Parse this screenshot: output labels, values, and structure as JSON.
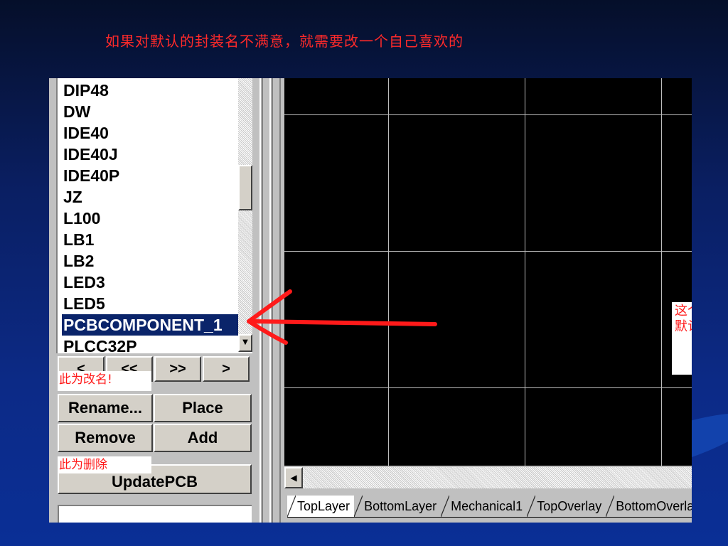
{
  "slide": {
    "title": "如果对默认的封装名不满意，就需要改一个自己喜欢的"
  },
  "component_list": {
    "items": [
      {
        "label": "DIP48",
        "selected": false
      },
      {
        "label": "DW",
        "selected": false
      },
      {
        "label": "IDE40",
        "selected": false
      },
      {
        "label": "IDE40J",
        "selected": false
      },
      {
        "label": "IDE40P",
        "selected": false
      },
      {
        "label": "JZ",
        "selected": false
      },
      {
        "label": "L100",
        "selected": false
      },
      {
        "label": "LB1",
        "selected": false
      },
      {
        "label": "LB2",
        "selected": false
      },
      {
        "label": "LED3",
        "selected": false
      },
      {
        "label": "LED5",
        "selected": false
      },
      {
        "label": "PCBCOMPONENT_1",
        "selected": true
      },
      {
        "label": "PLCC32P",
        "selected": false
      }
    ]
  },
  "nav_buttons": [
    "<",
    "<<",
    ">>",
    ">"
  ],
  "buttons": {
    "rename": "Rename...",
    "place": "Place",
    "remove": "Remove",
    "add": "Add",
    "update_pcb": "UpdatePCB"
  },
  "annotations": {
    "rename_note": "此为改名!",
    "remove_note": "此为删除",
    "callout": "这个就是我们新建的零件封装了，它的默认名字有点怪，可以改改它。"
  },
  "layer_tabs": [
    "TopLayer",
    "BottomLayer",
    "Mechanical1",
    "TopOverlay",
    "BottomOverlay"
  ],
  "colors": {
    "selection": "#0a246a",
    "annotation_red": "#ff1a1a",
    "canvas": "#000000",
    "grid": "#bdbdbd"
  }
}
